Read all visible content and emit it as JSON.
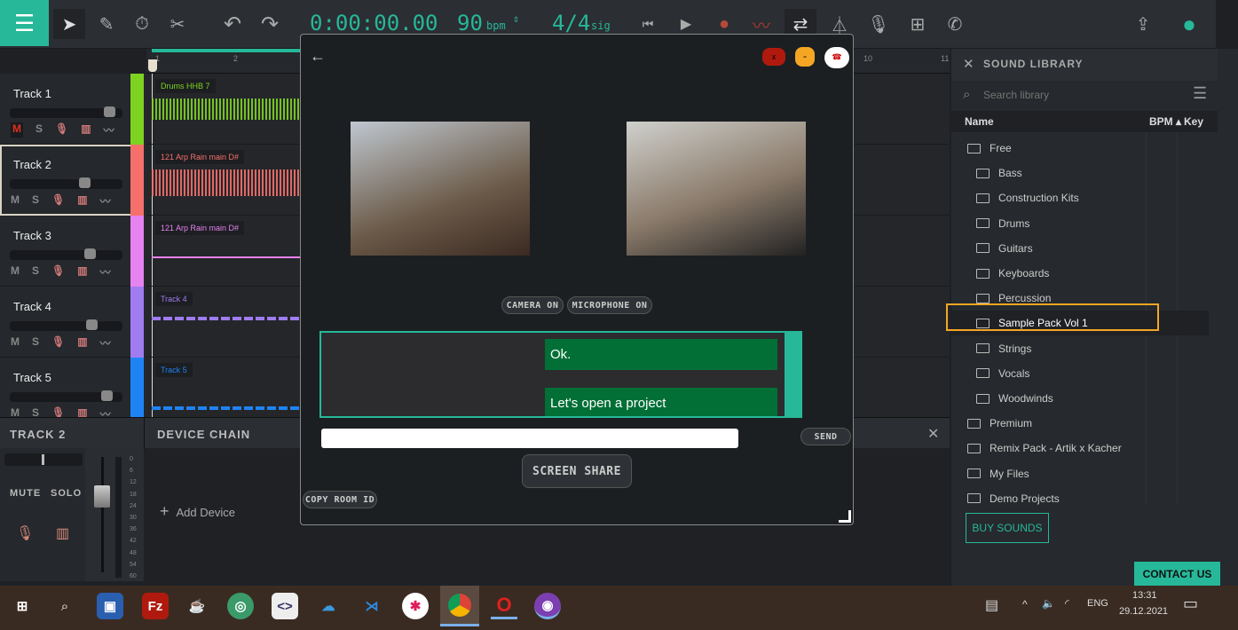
{
  "toolbar": {
    "time": "0:00:00.00",
    "bpm": "90",
    "bpm_unit": "bpm",
    "sig": "4/4",
    "sig_unit": "sig"
  },
  "ruler": {
    "marks": [
      "1",
      "2",
      "10",
      "11"
    ]
  },
  "tracks": [
    {
      "name": "Track 1",
      "color": "#7ed321",
      "clip": "Drums HHB 7",
      "volume": 0.93,
      "muted": true
    },
    {
      "name": "Track 2",
      "color": "#f5706a",
      "clip": "121 Arp Rain main D#",
      "volume": 0.68,
      "selected": true
    },
    {
      "name": "Track 3",
      "color": "#e683f0",
      "clip": "121 Arp Rain main D#",
      "volume": 0.74
    },
    {
      "name": "Track 4",
      "color": "#a07cf0",
      "clip": "Track 4",
      "volume": 0.75
    },
    {
      "name": "Track 5",
      "color": "#1e84f5",
      "clip": "Track 5",
      "volume": 0.9
    }
  ],
  "track_buttons": {
    "mute": "M",
    "solo": "S"
  },
  "bottom": {
    "track_title": "TRACK 2",
    "device_chain": "DEVICE CHAIN",
    "mute": "MUTE",
    "solo": "SOLO",
    "add_device": "Add Device",
    "meter_scale": [
      "0",
      "6",
      "12",
      "18",
      "24",
      "30",
      "36",
      "42",
      "48",
      "54",
      "60"
    ]
  },
  "dialog": {
    "back": "←",
    "camera": "CAMERA ON",
    "microphone": "MICROPHONE ON",
    "messages": [
      "Ok.",
      "Let's open a project"
    ],
    "message_input": "",
    "send": "SEND",
    "screen_share": "SCREEN SHARE",
    "copy_room": "COPY ROOM ID"
  },
  "library": {
    "title": "SOUND LIBRARY",
    "search_placeholder": "Search library",
    "col_name": "Name",
    "col_bpm": "BPM ▴",
    "col_key": "Key",
    "items": [
      {
        "label": "Free",
        "level": 0
      },
      {
        "label": "Bass",
        "level": 1
      },
      {
        "label": "Construction Kits",
        "level": 1
      },
      {
        "label": "Drums",
        "level": 1
      },
      {
        "label": "Guitars",
        "level": 1
      },
      {
        "label": "Keyboards",
        "level": 1
      },
      {
        "label": "Percussion",
        "level": 1
      },
      {
        "label": "Sample Pack Vol 1",
        "level": 1,
        "highlighted": true
      },
      {
        "label": "Strings",
        "level": 1
      },
      {
        "label": "Vocals",
        "level": 1
      },
      {
        "label": "Woodwinds",
        "level": 1
      },
      {
        "label": "Premium",
        "level": 0
      },
      {
        "label": "Remix Pack - Artik x Kacher",
        "level": 0
      },
      {
        "label": "My Files",
        "level": 0
      },
      {
        "label": "Demo Projects",
        "level": 0
      }
    ],
    "buy": "BUY SOUNDS",
    "contact": "CONTACT US"
  },
  "taskbar": {
    "lang": "ENG",
    "time": "13:31",
    "date": "29.12.2021"
  },
  "colors": {
    "accent": "#26b899",
    "highlight": "#f5a623",
    "chat": "#026f37"
  }
}
